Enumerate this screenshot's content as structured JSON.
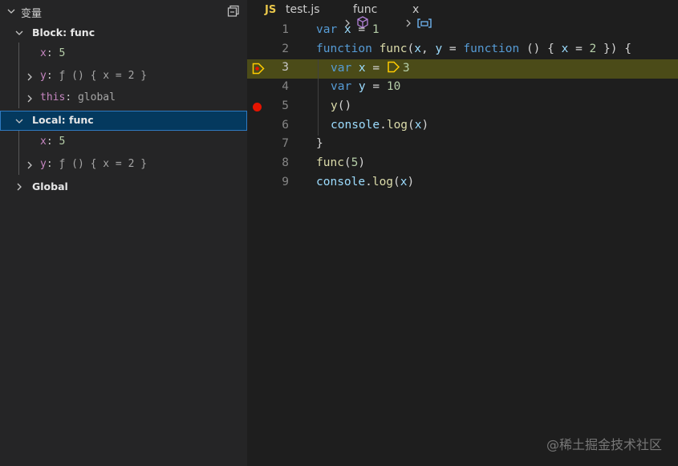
{
  "variables": {
    "title": "变量",
    "scopes": [
      {
        "label": "Block: func",
        "x_name": "x",
        "x_value": "5",
        "y_name": "y",
        "y_value": "ƒ () { x = 2 }",
        "this_name": "this",
        "this_value": "global"
      },
      {
        "label": "Local: func",
        "x_name": "x",
        "x_value": "5",
        "y_name": "y",
        "y_value": "ƒ () { x = 2 }"
      },
      {
        "label": "Global"
      }
    ]
  },
  "breadcrumb": {
    "lang_badge": "JS",
    "file": "test.js",
    "symbol": "func",
    "variable": "x"
  },
  "editor": {
    "line_numbers": [
      "1",
      "2",
      "3",
      "4",
      "5",
      "6",
      "7",
      "8",
      "9"
    ],
    "inline_value": "3",
    "lines": [
      {
        "t": "var",
        "a": " x ",
        "b": "= ",
        "c": "1"
      },
      {
        "t": "function",
        "f": " func",
        "p1": "(",
        "x": "x",
        "p2": ", ",
        "y": "y",
        "p3": " = ",
        "k2": "function",
        "p4": " () { ",
        "x2": "x",
        "p5": " = ",
        "n": "2",
        "p6": " }) {"
      },
      {
        "t": "var",
        "a": " x ",
        "b": "= "
      },
      {
        "t": "var",
        "a": " y ",
        "b": "= ",
        "c": "10"
      },
      {
        "f": "y",
        "p": "()"
      },
      {
        "id": "console",
        "p1": ".",
        "f": "log",
        "p2": "(",
        "x": "x",
        "p3": ")"
      },
      {
        "p": "}"
      },
      {
        "f": "func",
        "p1": "(",
        "n": "5",
        "p2": ")"
      },
      {
        "id": "console",
        "p1": ".",
        "f": "log",
        "p2": "(",
        "x": "x",
        "p3": ")"
      }
    ]
  },
  "watermark": "@稀土掘金技术社区",
  "colors": {
    "selection": "#04395e",
    "current_line": "#4b4b18",
    "breakpoint": "#e51400",
    "exec_arrow": "#ffcc00"
  }
}
